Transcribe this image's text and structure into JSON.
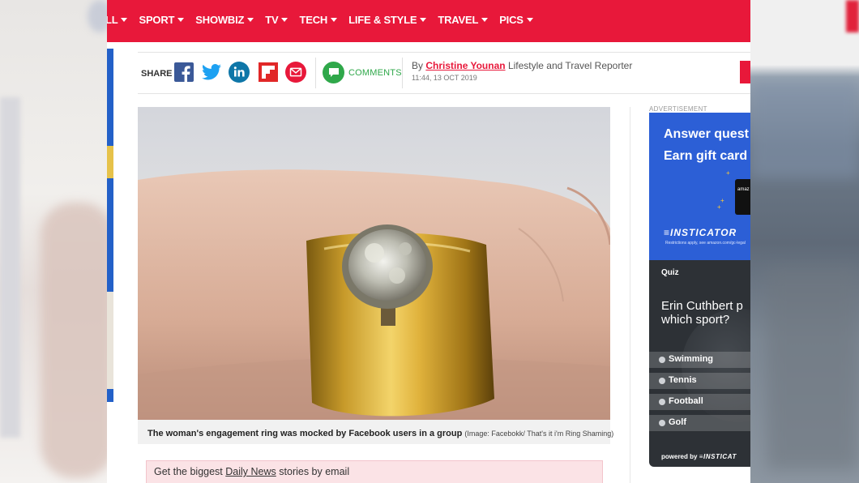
{
  "nav": {
    "items": [
      {
        "label": "LL",
        "has_dropdown": true
      },
      {
        "label": "SPORT",
        "has_dropdown": true
      },
      {
        "label": "SHOWBIZ",
        "has_dropdown": true
      },
      {
        "label": "TV",
        "has_dropdown": true
      },
      {
        "label": "TECH",
        "has_dropdown": true
      },
      {
        "label": "LIFE & STYLE",
        "has_dropdown": true
      },
      {
        "label": "TRAVEL",
        "has_dropdown": true
      },
      {
        "label": "PICS",
        "has_dropdown": true
      }
    ],
    "background_color": "#e8183a"
  },
  "share": {
    "label": "SHARE",
    "icons": [
      "facebook-icon",
      "twitter-icon",
      "linkedin-icon",
      "flipboard-icon",
      "email-icon"
    ],
    "comments_label": "COMMENTS"
  },
  "byline": {
    "prefix": "By",
    "author": "Christine Younan",
    "role": "Lifestyle and Travel Reporter",
    "timestamp": "11:44, 13 OCT 2019"
  },
  "article": {
    "image_caption": "The woman's engagement ring was mocked by Facebook users in a group",
    "image_credit": "(Image: Facebokk/ That's it i'm Ring Shaming)"
  },
  "newsletter": {
    "prefix": "Get the biggest",
    "link": "Daily News",
    "suffix": "stories by email"
  },
  "sidebar": {
    "ad_label": "ADVERTISEMENT",
    "ad": {
      "line1": "Answer quest",
      "line2": "Earn gift card",
      "amazon_label": "amaz",
      "brand": "≡INSTICATOR",
      "fine_print": "Restrictions apply, see amazon.com/gc-legal"
    },
    "quiz": {
      "tag": "Quiz",
      "question_line1": "Erin Cuthbert p",
      "question_line2": "which sport?",
      "options": [
        "Swimming",
        "Tennis",
        "Football",
        "Golf"
      ],
      "powered_prefix": "powered by",
      "powered_brand": "≡INSTICAT"
    }
  },
  "colors": {
    "accent": "#e8183a",
    "comments_green": "#2fa84a",
    "ad_blue": "#2c5fd6",
    "quiz_dark": "#2d3136"
  }
}
